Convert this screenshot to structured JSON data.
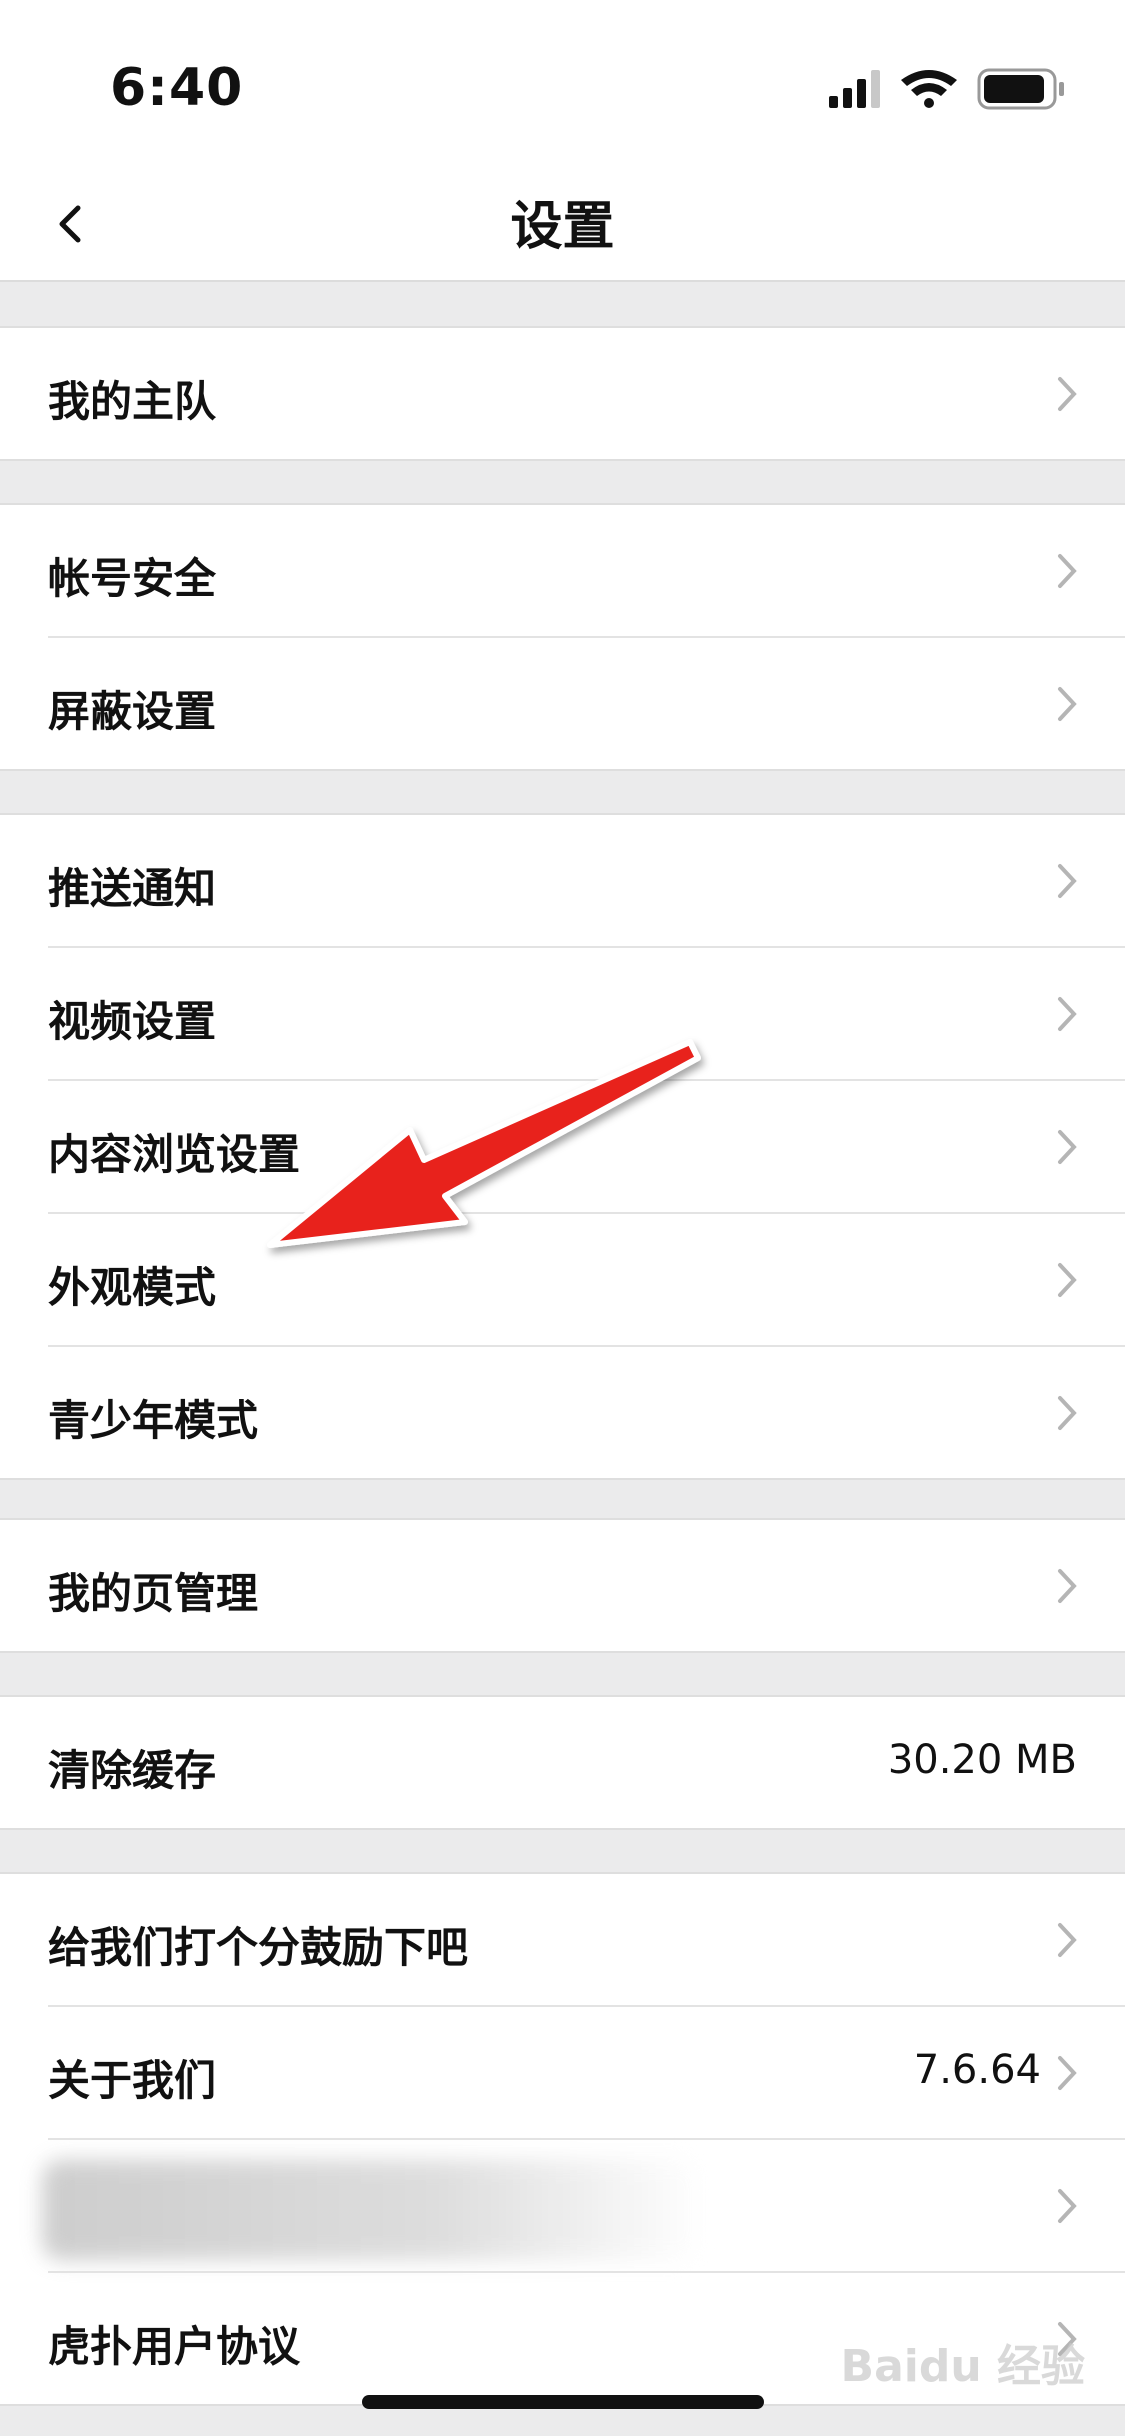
{
  "status": {
    "time": "6:40"
  },
  "nav": {
    "title": "设置"
  },
  "groups": [
    {
      "items": [
        {
          "label": "我的主队"
        }
      ]
    },
    {
      "items": [
        {
          "label": "帐号安全"
        },
        {
          "label": "屏蔽设置"
        }
      ]
    },
    {
      "items": [
        {
          "label": "推送通知"
        },
        {
          "label": "视频设置"
        },
        {
          "label": "内容浏览设置"
        },
        {
          "label": "外观模式"
        },
        {
          "label": "青少年模式"
        }
      ]
    },
    {
      "items": [
        {
          "label": "我的页管理"
        }
      ]
    },
    {
      "items": [
        {
          "label": "清除缓存",
          "value": "30.20 MB"
        }
      ]
    },
    {
      "items": [
        {
          "label": "给我们打个分鼓励下吧"
        },
        {
          "label": "关于我们",
          "value": "7.6.64"
        },
        {
          "label": ""
        },
        {
          "label": "虎扑用户协议"
        }
      ]
    }
  ],
  "annotation": {
    "arrow_color": "#e8201e"
  },
  "watermark": {
    "text": "Baidu 经验"
  }
}
